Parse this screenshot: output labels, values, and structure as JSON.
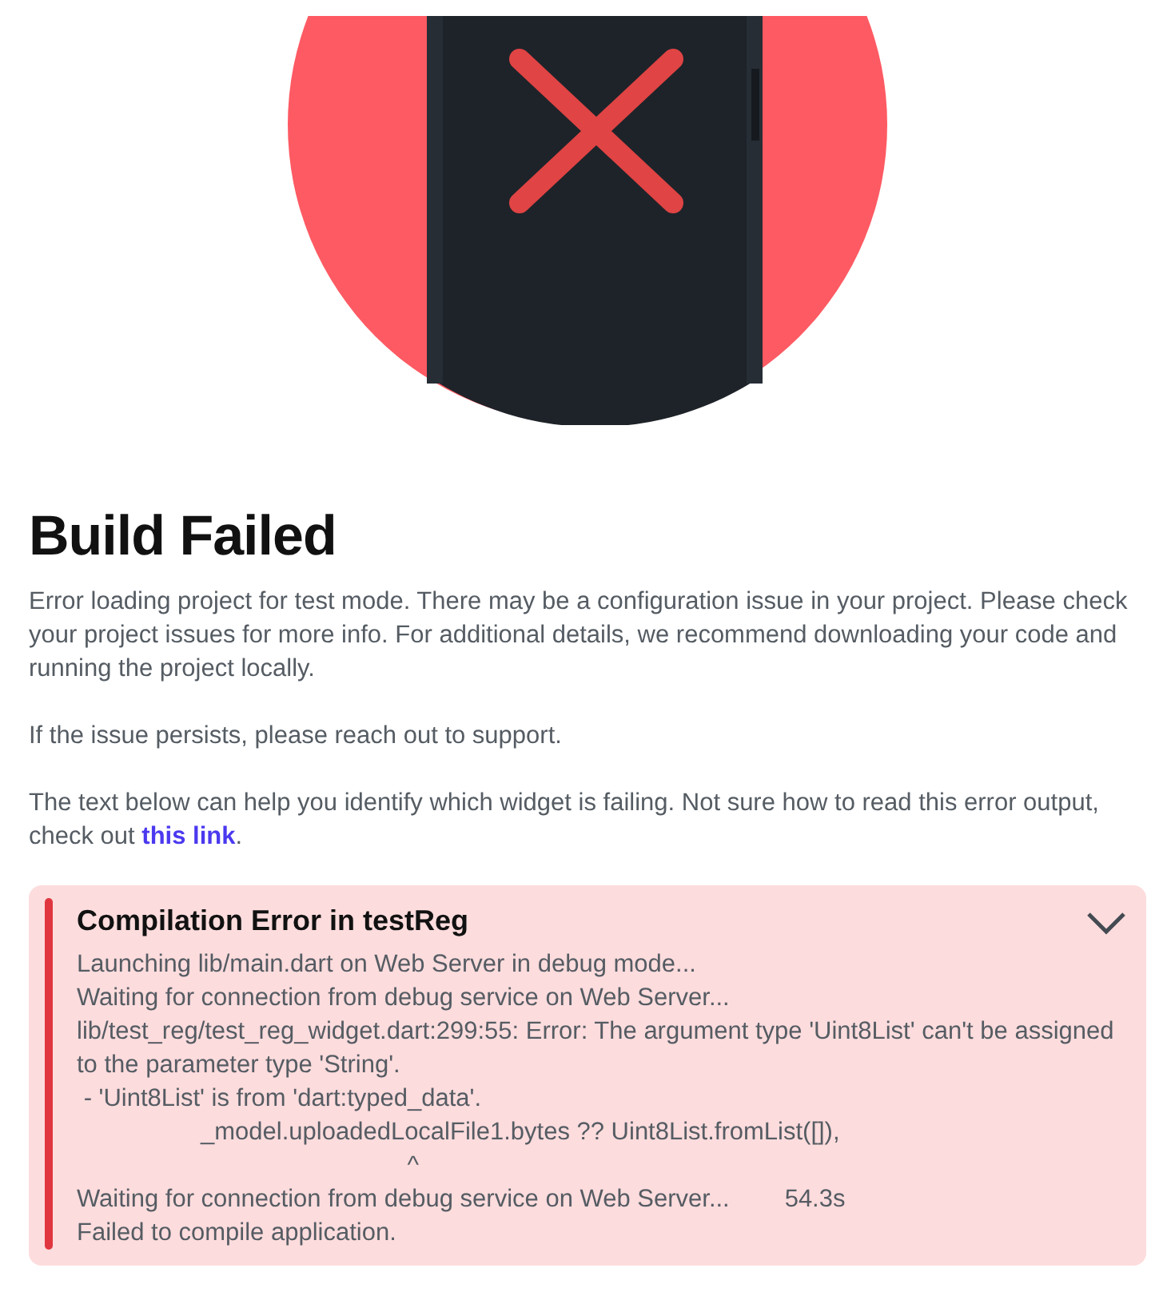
{
  "title": "Build Failed",
  "paragraphs": [
    "Error loading project for test mode. There may be a configuration issue in your project. Please check your project issues for more info. For additional details, we recommend downloading your code and running the project locally.",
    "If the issue persists, please reach out to support."
  ],
  "help": {
    "text": "The text below can help you identify which widget is failing. Not sure how to read this error output, check out ",
    "link": "this link",
    "after": "."
  },
  "error_panel": {
    "title": "Compilation Error in testReg",
    "expanded": true,
    "lines": [
      "Launching lib/main.dart on Web Server in debug mode...",
      "Waiting for connection from debug service on Web Server...",
      "lib/test_reg/test_reg_widget.dart:299:55: Error: The argument type 'Uint8List' can't be assigned to the parameter type 'String'.",
      " - 'Uint8List' is from 'dart:typed_data'.",
      "                  _model.uploadedLocalFile1.bytes ?? Uint8List.fromList([]),",
      "                                                ^",
      "Waiting for connection from debug service on Web Server...        54.3s",
      "Failed to compile application."
    ]
  }
}
